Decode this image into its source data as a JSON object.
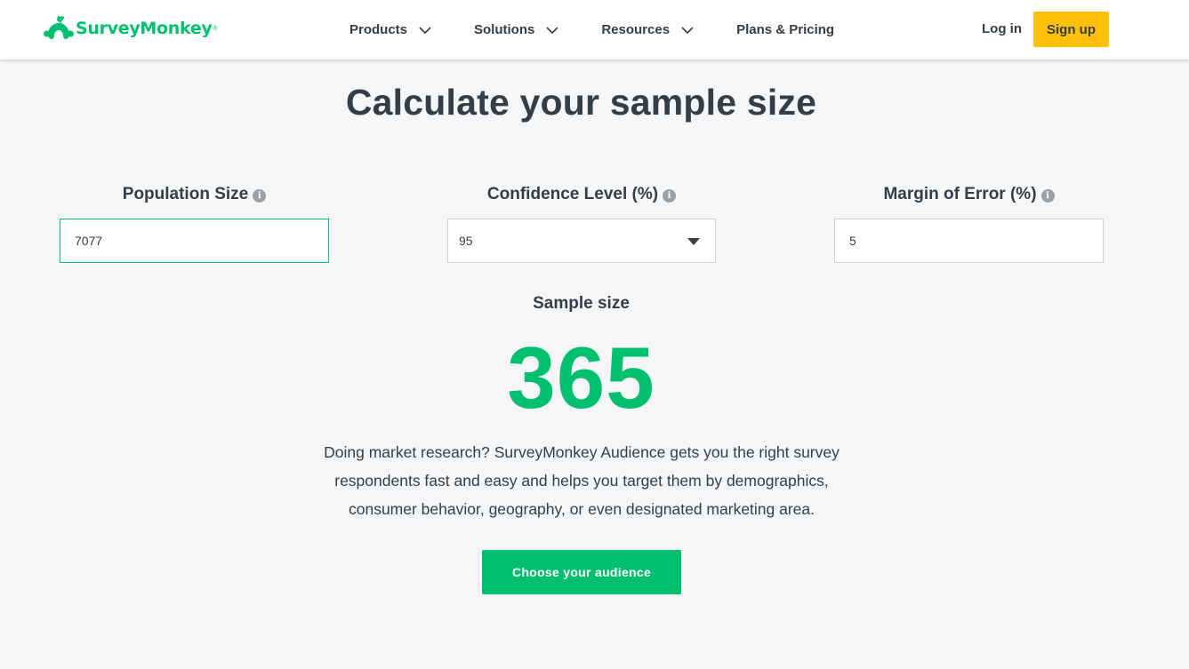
{
  "brand": {
    "name": "SurveyMonkey",
    "reg": "®",
    "color": "#00bf6f"
  },
  "nav": {
    "items": [
      {
        "label": "Products",
        "dropdown": true
      },
      {
        "label": "Solutions",
        "dropdown": true
      },
      {
        "label": "Resources",
        "dropdown": true
      },
      {
        "label": "Plans & Pricing",
        "dropdown": false
      }
    ],
    "login": "Log in",
    "signup": "Sign up"
  },
  "page": {
    "title": "Calculate your sample size"
  },
  "calculator": {
    "population": {
      "label": "Population Size",
      "value": "7077",
      "info_icon": "info-icon"
    },
    "confidence": {
      "label": "Confidence Level (%)",
      "value": "95",
      "info_icon": "info-icon"
    },
    "margin": {
      "label": "Margin of Error (%)",
      "value": "5",
      "info_icon": "info-icon"
    }
  },
  "result": {
    "label": "Sample size",
    "value": "365"
  },
  "blurb": {
    "line1": "Doing market research? SurveyMonkey Audience gets you the right survey",
    "line2": "respondents fast and easy and helps you target them by demographics,",
    "line3": "consumer behavior, geography, or even designated marketing area."
  },
  "cta": {
    "label": "Choose your audience"
  },
  "colors": {
    "accent": "#00bf6f",
    "signup": "#ffc107",
    "text": "#333e48",
    "background": "#f5f6f8"
  }
}
